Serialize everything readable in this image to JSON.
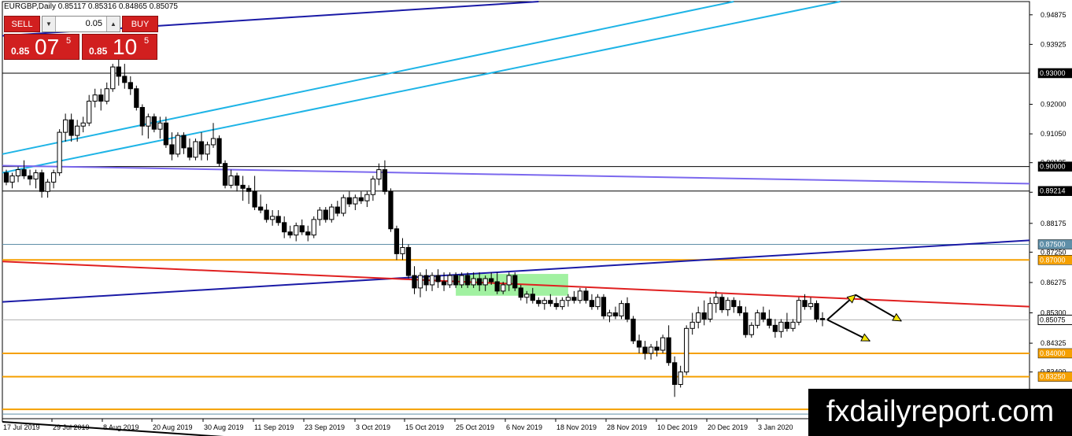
{
  "header": {
    "title": "EURGBP,Daily  0.85117 0.85316 0.84865 0.85075"
  },
  "trade_panel": {
    "sell_label": "SELL",
    "buy_label": "BUY",
    "lot": "0.05",
    "sell_price": {
      "prefix": "0.85",
      "main": "07",
      "sup": "5"
    },
    "buy_price": {
      "prefix": "0.85",
      "main": "10",
      "sup": "5"
    }
  },
  "watermark": "fxdailyreport.com",
  "colors": {
    "price_line": "#000000",
    "green_zone": "#90ee90",
    "cyan": "#1eb4e6",
    "blue": "#1a1aa6",
    "purple": "#7b68ee",
    "red": "#e02020",
    "orange": "#f5a000",
    "steel": "#5f8fa8"
  },
  "chart_data": {
    "type": "candlestick",
    "symbol": "EURGBP",
    "timeframe": "Daily",
    "ylim": [
      0.819,
      0.953
    ],
    "y_ticks": [
      "0.94875",
      "0.93925",
      "0.92000",
      "0.91050",
      "0.90125",
      "0.89175",
      "0.88175",
      "0.87250",
      "0.86275",
      "0.85300",
      "0.84325",
      "0.83400",
      "0.82425"
    ],
    "x_ticks": [
      "17 Jul 2019",
      "29 Jul 2019",
      "8 Aug 2019",
      "20 Aug 2019",
      "30 Aug 2019",
      "11 Sep 2019",
      "23 Sep 2019",
      "3 Oct 2019",
      "15 Oct 2019",
      "25 Oct 2019",
      "6 Nov 2019",
      "18 Nov 2019",
      "28 Nov 2019",
      "10 Dec 2019",
      "20 Dec 2019",
      "3 Jan 2020"
    ],
    "current_price": "0.85075",
    "horizontal_levels": [
      {
        "label": "0.93000",
        "value": 0.93,
        "color": "#000000"
      },
      {
        "label": "0.90000",
        "value": 0.9,
        "color": "#000000"
      },
      {
        "label": "0.89214",
        "value": 0.89214,
        "color": "#000000"
      },
      {
        "label": "0.87500",
        "value": 0.875,
        "color": "#5f8fa8"
      },
      {
        "label": "0.87000",
        "value": 0.87,
        "color": "#f5a000"
      },
      {
        "label": "0.84000",
        "value": 0.84,
        "color": "#f5a000"
      },
      {
        "label": "0.83250",
        "value": 0.8325,
        "color": "#f5a000"
      }
    ],
    "candles": [
      [
        0.898,
        0.899,
        0.894,
        0.895
      ],
      [
        0.895,
        0.898,
        0.893,
        0.897
      ],
      [
        0.897,
        0.9,
        0.895,
        0.899
      ],
      [
        0.899,
        0.902,
        0.896,
        0.897
      ],
      [
        0.897,
        0.899,
        0.894,
        0.896
      ],
      [
        0.896,
        0.899,
        0.893,
        0.898
      ],
      [
        0.898,
        0.899,
        0.89,
        0.892
      ],
      [
        0.892,
        0.896,
        0.89,
        0.895
      ],
      [
        0.895,
        0.899,
        0.893,
        0.898
      ],
      [
        0.898,
        0.912,
        0.897,
        0.911
      ],
      [
        0.911,
        0.917,
        0.908,
        0.915
      ],
      [
        0.915,
        0.917,
        0.908,
        0.91
      ],
      [
        0.91,
        0.915,
        0.908,
        0.913
      ],
      [
        0.913,
        0.916,
        0.911,
        0.914
      ],
      [
        0.914,
        0.923,
        0.913,
        0.921
      ],
      [
        0.921,
        0.925,
        0.919,
        0.923
      ],
      [
        0.923,
        0.925,
        0.918,
        0.921
      ],
      [
        0.921,
        0.927,
        0.92,
        0.925
      ],
      [
        0.925,
        0.933,
        0.924,
        0.932
      ],
      [
        0.932,
        0.935,
        0.926,
        0.929
      ],
      [
        0.929,
        0.933,
        0.925,
        0.927
      ],
      [
        0.927,
        0.929,
        0.923,
        0.925
      ],
      [
        0.925,
        0.926,
        0.918,
        0.919
      ],
      [
        0.919,
        0.92,
        0.91,
        0.913
      ],
      [
        0.913,
        0.917,
        0.909,
        0.916
      ],
      [
        0.916,
        0.917,
        0.911,
        0.912
      ],
      [
        0.912,
        0.916,
        0.909,
        0.914
      ],
      [
        0.914,
        0.916,
        0.906,
        0.907
      ],
      [
        0.907,
        0.911,
        0.902,
        0.904
      ],
      [
        0.904,
        0.911,
        0.903,
        0.91
      ],
      [
        0.91,
        0.911,
        0.904,
        0.906
      ],
      [
        0.906,
        0.909,
        0.902,
        0.903
      ],
      [
        0.903,
        0.909,
        0.902,
        0.908
      ],
      [
        0.908,
        0.911,
        0.902,
        0.904
      ],
      [
        0.904,
        0.908,
        0.902,
        0.907
      ],
      [
        0.907,
        0.914,
        0.906,
        0.909
      ],
      [
        0.909,
        0.91,
        0.9,
        0.901
      ],
      [
        0.901,
        0.902,
        0.893,
        0.894
      ],
      [
        0.894,
        0.899,
        0.893,
        0.897
      ],
      [
        0.897,
        0.898,
        0.892,
        0.894
      ],
      [
        0.894,
        0.897,
        0.889,
        0.893
      ],
      [
        0.893,
        0.894,
        0.888,
        0.892
      ],
      [
        0.892,
        0.897,
        0.886,
        0.887
      ],
      [
        0.887,
        0.891,
        0.885,
        0.886
      ],
      [
        0.886,
        0.888,
        0.882,
        0.883
      ],
      [
        0.883,
        0.886,
        0.881,
        0.884
      ],
      [
        0.884,
        0.886,
        0.881,
        0.882
      ],
      [
        0.882,
        0.884,
        0.877,
        0.879
      ],
      [
        0.879,
        0.881,
        0.877,
        0.878
      ],
      [
        0.878,
        0.882,
        0.876,
        0.881
      ],
      [
        0.881,
        0.883,
        0.878,
        0.879
      ],
      [
        0.879,
        0.881,
        0.876,
        0.878
      ],
      [
        0.878,
        0.884,
        0.877,
        0.883
      ],
      [
        0.883,
        0.887,
        0.881,
        0.886
      ],
      [
        0.886,
        0.887,
        0.882,
        0.883
      ],
      [
        0.883,
        0.888,
        0.882,
        0.887
      ],
      [
        0.887,
        0.889,
        0.884,
        0.885
      ],
      [
        0.885,
        0.891,
        0.884,
        0.89
      ],
      [
        0.89,
        0.892,
        0.887,
        0.888
      ],
      [
        0.888,
        0.891,
        0.886,
        0.89
      ],
      [
        0.89,
        0.892,
        0.888,
        0.889
      ],
      [
        0.889,
        0.892,
        0.887,
        0.891
      ],
      [
        0.891,
        0.897,
        0.889,
        0.896
      ],
      [
        0.896,
        0.901,
        0.894,
        0.899
      ],
      [
        0.899,
        0.902,
        0.891,
        0.892
      ],
      [
        0.892,
        0.893,
        0.879,
        0.88
      ],
      [
        0.88,
        0.881,
        0.87,
        0.872
      ],
      [
        0.872,
        0.877,
        0.87,
        0.874
      ],
      [
        0.874,
        0.875,
        0.864,
        0.865
      ],
      [
        0.865,
        0.868,
        0.859,
        0.861
      ],
      [
        0.861,
        0.866,
        0.858,
        0.865
      ],
      [
        0.865,
        0.867,
        0.86,
        0.862
      ],
      [
        0.862,
        0.866,
        0.86,
        0.865
      ],
      [
        0.865,
        0.867,
        0.861,
        0.863
      ],
      [
        0.863,
        0.866,
        0.86,
        0.862
      ],
      [
        0.862,
        0.866,
        0.861,
        0.865
      ],
      [
        0.865,
        0.866,
        0.861,
        0.862
      ],
      [
        0.862,
        0.866,
        0.861,
        0.865
      ],
      [
        0.865,
        0.866,
        0.861,
        0.862
      ],
      [
        0.862,
        0.866,
        0.861,
        0.864
      ],
      [
        0.864,
        0.866,
        0.86,
        0.862
      ],
      [
        0.862,
        0.865,
        0.86,
        0.864
      ],
      [
        0.864,
        0.866,
        0.862,
        0.863
      ],
      [
        0.863,
        0.866,
        0.859,
        0.86
      ],
      [
        0.86,
        0.863,
        0.859,
        0.862
      ],
      [
        0.862,
        0.866,
        0.86,
        0.865
      ],
      [
        0.865,
        0.866,
        0.86,
        0.861
      ],
      [
        0.861,
        0.862,
        0.857,
        0.858
      ],
      [
        0.858,
        0.86,
        0.856,
        0.859
      ],
      [
        0.859,
        0.861,
        0.856,
        0.857
      ],
      [
        0.857,
        0.858,
        0.855,
        0.856
      ],
      [
        0.856,
        0.858,
        0.854,
        0.857
      ],
      [
        0.857,
        0.859,
        0.855,
        0.856
      ],
      [
        0.856,
        0.858,
        0.854,
        0.855
      ],
      [
        0.855,
        0.858,
        0.854,
        0.857
      ],
      [
        0.857,
        0.859,
        0.855,
        0.858
      ],
      [
        0.858,
        0.86,
        0.856,
        0.857
      ],
      [
        0.857,
        0.861,
        0.856,
        0.86
      ],
      [
        0.86,
        0.861,
        0.856,
        0.857
      ],
      [
        0.857,
        0.859,
        0.854,
        0.855
      ],
      [
        0.855,
        0.859,
        0.854,
        0.858
      ],
      [
        0.858,
        0.859,
        0.851,
        0.852
      ],
      [
        0.852,
        0.854,
        0.85,
        0.853
      ],
      [
        0.853,
        0.855,
        0.851,
        0.852
      ],
      [
        0.852,
        0.857,
        0.851,
        0.856
      ],
      [
        0.856,
        0.858,
        0.85,
        0.851
      ],
      [
        0.851,
        0.852,
        0.843,
        0.844
      ],
      [
        0.844,
        0.846,
        0.84,
        0.842
      ],
      [
        0.842,
        0.844,
        0.838,
        0.84
      ],
      [
        0.84,
        0.843,
        0.838,
        0.842
      ],
      [
        0.842,
        0.844,
        0.839,
        0.841
      ],
      [
        0.841,
        0.846,
        0.84,
        0.845
      ],
      [
        0.845,
        0.849,
        0.836,
        0.837
      ],
      [
        0.837,
        0.839,
        0.826,
        0.83
      ],
      [
        0.83,
        0.836,
        0.829,
        0.834
      ],
      [
        0.834,
        0.849,
        0.833,
        0.848
      ],
      [
        0.848,
        0.853,
        0.846,
        0.85
      ],
      [
        0.85,
        0.855,
        0.848,
        0.853
      ],
      [
        0.853,
        0.857,
        0.849,
        0.851
      ],
      [
        0.851,
        0.858,
        0.85,
        0.856
      ],
      [
        0.856,
        0.86,
        0.853,
        0.858
      ],
      [
        0.858,
        0.859,
        0.853,
        0.854
      ],
      [
        0.854,
        0.858,
        0.852,
        0.857
      ],
      [
        0.857,
        0.858,
        0.853,
        0.855
      ],
      [
        0.855,
        0.857,
        0.852,
        0.853
      ],
      [
        0.853,
        0.855,
        0.845,
        0.846
      ],
      [
        0.846,
        0.85,
        0.845,
        0.849
      ],
      [
        0.849,
        0.854,
        0.848,
        0.853
      ],
      [
        0.853,
        0.855,
        0.85,
        0.851
      ],
      [
        0.851,
        0.854,
        0.848,
        0.849
      ],
      [
        0.849,
        0.851,
        0.845,
        0.847
      ],
      [
        0.847,
        0.851,
        0.845,
        0.85
      ],
      [
        0.85,
        0.853,
        0.847,
        0.848
      ],
      [
        0.848,
        0.851,
        0.847,
        0.85
      ],
      [
        0.85,
        0.858,
        0.849,
        0.857
      ],
      [
        0.857,
        0.859,
        0.854,
        0.855
      ],
      [
        0.855,
        0.858,
        0.854,
        0.856
      ],
      [
        0.856,
        0.857,
        0.85,
        0.851
      ],
      [
        0.8512,
        0.8532,
        0.8487,
        0.8508
      ]
    ],
    "overlay_lines": [
      {
        "color": "#1a1aa6",
        "width": 2,
        "from": [
          0,
          0.942
        ],
        "to": [
          90,
          0.953
        ]
      },
      {
        "color": "#1eb4e6",
        "width": 2,
        "from": [
          0,
          0.904
        ],
        "to": [
          123,
          0.953
        ]
      },
      {
        "color": "#1eb4e6",
        "width": 2,
        "from": [
          0,
          0.898
        ],
        "to": [
          141,
          0.953
        ]
      },
      {
        "color": "#7b68ee",
        "width": 2,
        "from": [
          0,
          0.9003
        ],
        "to": [
          191,
          0.8945
        ]
      },
      {
        "color": "#1a1aa6",
        "width": 2,
        "from": [
          0,
          0.8565
        ],
        "to": [
          191,
          0.8763
        ]
      },
      {
        "color": "#e02020",
        "width": 2,
        "from": [
          0,
          0.8695
        ],
        "to": [
          191,
          0.855
        ]
      },
      {
        "color": "#000000",
        "width": 2,
        "from": [
          0,
          0.818
        ],
        "to": [
          46,
          0.812
        ]
      }
    ]
  }
}
